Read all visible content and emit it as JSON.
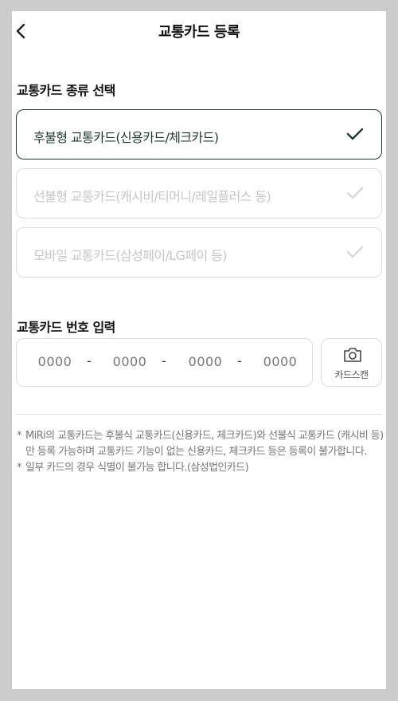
{
  "header": {
    "title": "교통카드 등록",
    "back_icon": "chevron-left-icon"
  },
  "card_type_section": {
    "title": "교통카드 종류 선택",
    "options": [
      {
        "label": "후불형 교통카드(신용카드/체크카드)",
        "selected": true
      },
      {
        "label": "선불형 교통카드(캐시비/티머니/레일플러스 등)",
        "selected": false
      },
      {
        "label": "모바일 교통카드(삼성페이/LG페이 등)",
        "selected": false
      }
    ]
  },
  "card_number_section": {
    "title": "교통카드 번호 입력",
    "segments": [
      "0000",
      "0000",
      "0000",
      "0000"
    ],
    "separator": "-",
    "scan_button_label": "카드스캔",
    "scan_icon": "camera-icon"
  },
  "notes": [
    "MiRi의 교통카드는 후불식 교통카드(신용카드, 체크카드)와 선불식 교통카드 (캐시비 등)만 등록 가능하며 교통카드 기능이 없는 신용카드, 체크카드 등은 등록이 불가합니다.",
    "일부 카드의 경우 식별이 불가능 합니다.(삼성법인카드)"
  ],
  "note_marker": "*",
  "colors": {
    "background": "#cccccc",
    "surface": "#ffffff",
    "selected_border": "#1e3a30",
    "inactive_text": "#c6c6c6",
    "border": "#dcdcdc"
  }
}
